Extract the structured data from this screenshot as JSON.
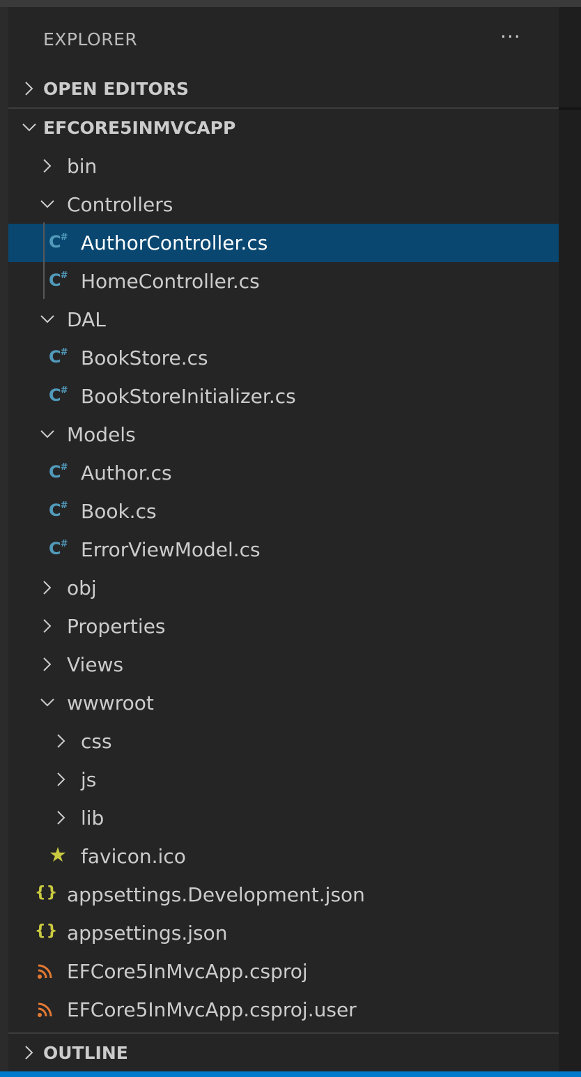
{
  "explorer": {
    "title": "EXPLORER",
    "more_icon": "ellipsis-icon",
    "more": "···"
  },
  "sections": {
    "open_editors": "OPEN EDITORS",
    "project": "EFCORE5INMVCAPP",
    "outline": "OUTLINE"
  },
  "tree": [
    {
      "name": "bin",
      "kind": "folder",
      "expanded": false,
      "depth": 1
    },
    {
      "name": "Controllers",
      "kind": "folder",
      "expanded": true,
      "depth": 1
    },
    {
      "name": "AuthorController.cs",
      "kind": "cs",
      "depth": 2,
      "selected": true
    },
    {
      "name": "HomeController.cs",
      "kind": "cs",
      "depth": 2
    },
    {
      "name": "DAL",
      "kind": "folder",
      "expanded": true,
      "depth": 1
    },
    {
      "name": "BookStore.cs",
      "kind": "cs",
      "depth": 2
    },
    {
      "name": "BookStoreInitializer.cs",
      "kind": "cs",
      "depth": 2
    },
    {
      "name": "Models",
      "kind": "folder",
      "expanded": true,
      "depth": 1
    },
    {
      "name": "Author.cs",
      "kind": "cs",
      "depth": 2
    },
    {
      "name": "Book.cs",
      "kind": "cs",
      "depth": 2
    },
    {
      "name": "ErrorViewModel.cs",
      "kind": "cs",
      "depth": 2
    },
    {
      "name": "obj",
      "kind": "folder",
      "expanded": false,
      "depth": 1
    },
    {
      "name": "Properties",
      "kind": "folder",
      "expanded": false,
      "depth": 1
    },
    {
      "name": "Views",
      "kind": "folder",
      "expanded": false,
      "depth": 1
    },
    {
      "name": "wwwroot",
      "kind": "folder",
      "expanded": true,
      "depth": 1
    },
    {
      "name": "css",
      "kind": "folder",
      "expanded": false,
      "depth": 2
    },
    {
      "name": "js",
      "kind": "folder",
      "expanded": false,
      "depth": 2
    },
    {
      "name": "lib",
      "kind": "folder",
      "expanded": false,
      "depth": 2
    },
    {
      "name": "favicon.ico",
      "kind": "ico",
      "depth": 2
    },
    {
      "name": "appsettings.Development.json",
      "kind": "json",
      "depth": 1
    },
    {
      "name": "appsettings.json",
      "kind": "json",
      "depth": 1
    },
    {
      "name": "EFCore5InMvcApp.csproj",
      "kind": "rss",
      "depth": 1
    },
    {
      "name": "EFCore5InMvcApp.csproj.user",
      "kind": "rss",
      "depth": 1
    }
  ],
  "icons": {
    "folder_collapsed": "chevron-right-icon",
    "folder_expanded": "chevron-down-icon",
    "cs": "csharp-file-icon",
    "json": "json-file-icon",
    "ico": "star-icon",
    "rss": "rss-icon"
  },
  "colors": {
    "background": "#252526",
    "selection": "#094771",
    "csharp": "#519aba",
    "json": "#cbcb41",
    "favicon": "#cbcb41",
    "csproj": "#e37933",
    "statusbar": "#007acc"
  }
}
